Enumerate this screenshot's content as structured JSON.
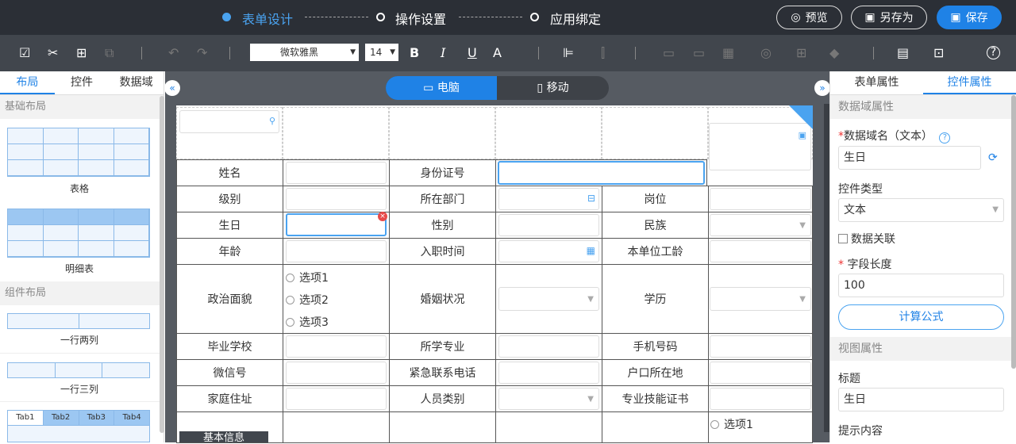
{
  "header": {
    "steps": [
      {
        "label": "表单设计",
        "active": true
      },
      {
        "label": "操作设置",
        "active": false
      },
      {
        "label": "应用绑定",
        "active": false
      }
    ],
    "preview_label": "预览",
    "saveas_label": "另存为",
    "save_label": "保存"
  },
  "toolbar": {
    "font_family": "微软雅黑",
    "font_size": "14",
    "bold": "B",
    "italic": "I",
    "underline": "U",
    "font_color": "A",
    "help": "?"
  },
  "left_panel": {
    "tabs": [
      "布局",
      "控件",
      "数据域"
    ],
    "active_tab": "布局",
    "sections": {
      "basic": "基础布局",
      "component": "组件布局"
    },
    "items": {
      "table": "表格",
      "detail_table": "明细表",
      "one_row_two_cols": "一行两列",
      "one_row_three_cols": "一行三列"
    },
    "tab_preview": [
      "Tab1",
      "Tab2",
      "Tab3",
      "Tab4"
    ]
  },
  "device_toggle": {
    "desktop": "电脑",
    "mobile": "移动",
    "active": "电脑"
  },
  "form": {
    "rows": [
      {
        "cells": [
          "姓名",
          "",
          "身份证号",
          ""
        ]
      },
      {
        "cells": [
          "级别",
          "",
          "所在部门",
          "",
          "岗位",
          ""
        ]
      },
      {
        "cells": [
          "生日",
          "",
          "性别",
          "",
          "民族",
          ""
        ]
      },
      {
        "cells": [
          "年龄",
          "",
          "入职时间",
          "",
          "本单位工龄",
          ""
        ]
      },
      {
        "cells": [
          "政治面貌",
          "",
          "婚姻状况",
          "",
          "学历",
          ""
        ]
      },
      {
        "cells": [
          "毕业学校",
          "",
          "所学专业",
          "",
          "手机号码",
          ""
        ]
      },
      {
        "cells": [
          "微信号",
          "",
          "紧急联系电话",
          "",
          "户口所在地",
          ""
        ]
      },
      {
        "cells": [
          "家庭住址",
          "",
          "人员类别",
          "",
          "专业技能证书",
          ""
        ]
      }
    ],
    "radio_options": [
      "选项1",
      "选项2",
      "选项3"
    ],
    "last_row_option": "选项1",
    "bottom_tab": "基本信息",
    "add_tab": "+"
  },
  "right_panel": {
    "tabs": [
      "表单属性",
      "控件属性"
    ],
    "active_tab": "控件属性",
    "section_data": "数据域属性",
    "field_name_label": "数据域名（文本）",
    "field_name_value": "生日",
    "control_type_label": "控件类型",
    "control_type_value": "文本",
    "data_link_label": "数据关联",
    "field_length_label": "字段长度",
    "field_length_value": "100",
    "formula_button": "计算公式",
    "section_view": "视图属性",
    "title_label": "标题",
    "title_value": "生日",
    "hint_label": "提示内容"
  },
  "colors": {
    "accent": "#1f82e6",
    "header_bg": "#2b2f36",
    "toolbar_bg": "#41464d",
    "canvas_bg": "#565b62",
    "required": "#e33333"
  }
}
